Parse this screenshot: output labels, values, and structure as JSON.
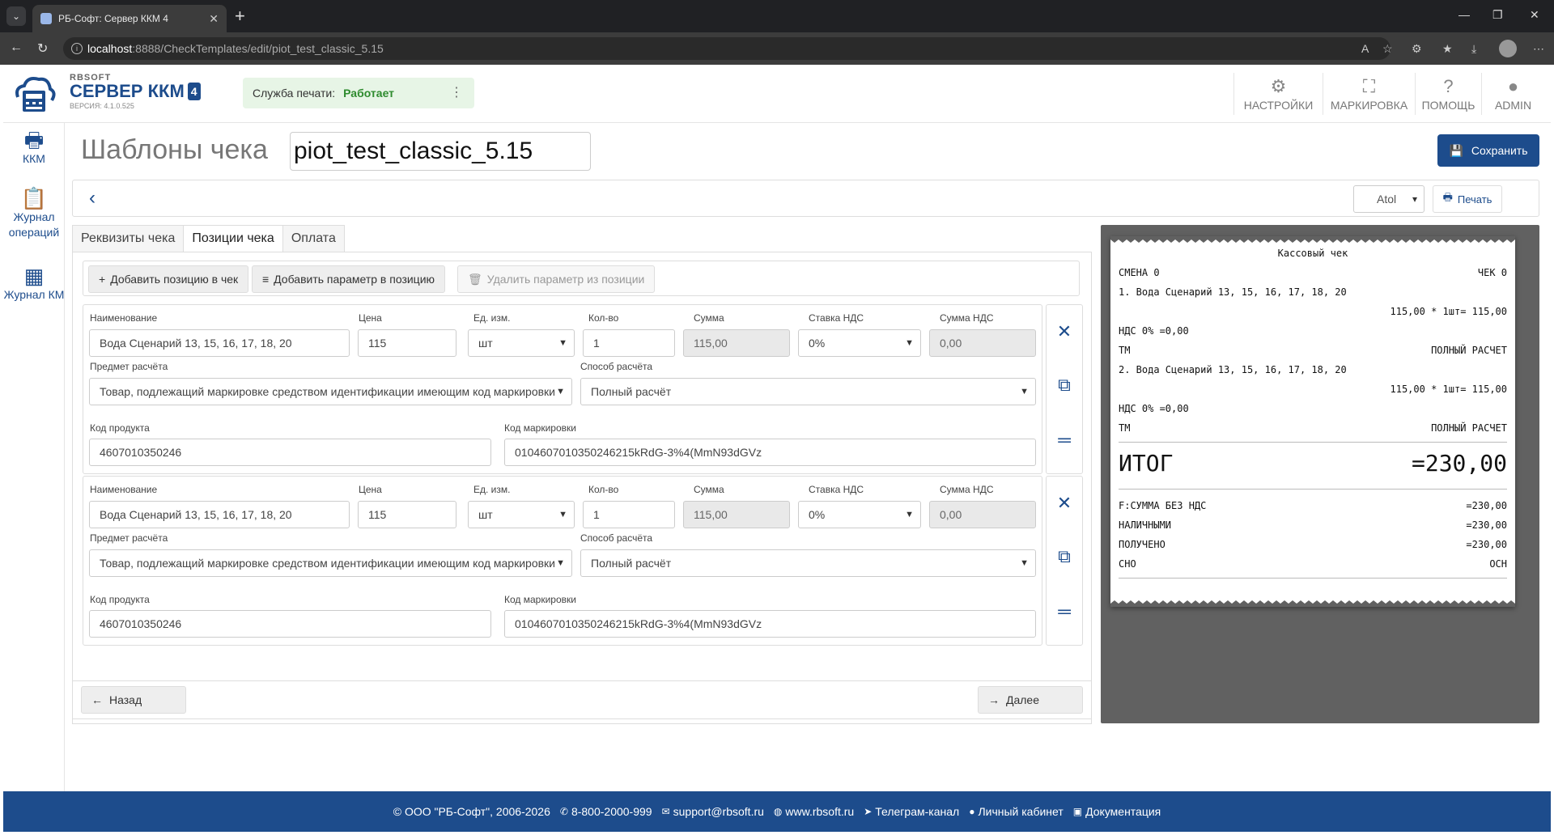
{
  "browser": {
    "tab_title": "РБ-Софт: Сервер ККМ 4",
    "url_host": "localhost",
    "url_path": ":8888/CheckTemplates/edit/piot_test_classic_5.15"
  },
  "header": {
    "logo_small": "RBSOFT",
    "logo_big": "СЕРВЕР ККМ",
    "logo_badge": "4",
    "version": "ВЕРСИЯ: 4.1.0.525",
    "print_service_label": "Служба печати:",
    "print_service_status": "Работает",
    "nav": [
      {
        "label": "НАСТРОЙКИ",
        "icon": "gear-icon"
      },
      {
        "label": "МАРКИРОВКА",
        "icon": "scan-icon"
      },
      {
        "label": "ПОМОЩЬ",
        "icon": "help-icon"
      },
      {
        "label": "ADMIN",
        "icon": "user-icon"
      }
    ]
  },
  "sidebar": {
    "items": [
      {
        "label": "ККМ",
        "icon": "printer-icon"
      },
      {
        "label": "Журнал операций",
        "icon": "clipboard-icon"
      },
      {
        "label": "Журнал КМ",
        "icon": "qr-icon"
      }
    ]
  },
  "main": {
    "title": "Шаблоны чека",
    "template_name": "piot_test_classic_5.15",
    "save_label": "Сохранить",
    "printer_value": "Atol",
    "print_label": "Печать",
    "tabs": [
      "Реквизиты чека",
      "Позиции чека",
      "Оплата"
    ],
    "actions": {
      "add_item": "Добавить позицию в чек",
      "add_param": "Добавить параметр в позицию",
      "remove_param": "Удалить параметр из позиции"
    },
    "labels": {
      "name": "Наименование",
      "price": "Цена",
      "unit": "Ед. изм.",
      "qty": "Кол-во",
      "sum": "Сумма",
      "vat_rate": "Ставка НДС",
      "vat_sum": "Сумма НДС",
      "subject": "Предмет расчёта",
      "method": "Способ расчёта",
      "product_code": "Код продукта",
      "mark_code": "Код маркировки"
    },
    "items": [
      {
        "name": "Вода Сценарий 13, 15, 16, 17, 18, 20",
        "price": "115",
        "unit": "шт",
        "qty": "1",
        "sum": "115,00",
        "vat_rate": "0%",
        "vat_sum": "0,00",
        "subject": "Товар, подлежащий маркировке средством идентификации имеющим код маркировки",
        "method": "Полный расчёт",
        "product_code": "4607010350246",
        "mark_code": "0104607010350246215kRdG-3%4(MmN93dGVz"
      },
      {
        "name": "Вода Сценарий 13, 15, 16, 17, 18, 20",
        "price": "115",
        "unit": "шт",
        "qty": "1",
        "sum": "115,00",
        "vat_rate": "0%",
        "vat_sum": "0,00",
        "subject": "Товар, подлежащий маркировке средством идентификации имеющим код маркировки",
        "method": "Полный расчёт",
        "product_code": "4607010350246",
        "mark_code": "0104607010350246215kRdG-3%4(MmN93dGVz"
      }
    ],
    "back_label": "Назад",
    "next_label": "Далее"
  },
  "receipt": {
    "title": "Кассовый чек",
    "shift": "СМЕНА 0",
    "check": "ЧЕК 0",
    "lines": [
      {
        "name": "1. Вода Сценарий 13, 15, 16, 17, 18, 20",
        "calc": "115,00 * 1шт= 115,00",
        "vat": "НДС 0% =0,00",
        "tm": "ТМ",
        "mode": "ПОЛНЫЙ РАСЧЕТ"
      },
      {
        "name": "2. Вода Сценарий 13, 15, 16, 17, 18, 20",
        "calc": "115,00 * 1шт= 115,00",
        "vat": "НДС 0% =0,00",
        "tm": "ТМ",
        "mode": "ПОЛНЫЙ РАСЧЕТ"
      }
    ],
    "total_label": "ИТОГ",
    "total_value": "=230,00",
    "summary": [
      {
        "label": "F:СУММА БЕЗ НДС",
        "value": "=230,00"
      },
      {
        "label": "НАЛИЧНЫМИ",
        "value": "=230,00"
      },
      {
        "label": "ПОЛУЧЕНО",
        "value": "=230,00"
      },
      {
        "label": "СНО",
        "value": "ОСН"
      }
    ]
  },
  "footer": {
    "copyright": "© ООО \"РБ-Софт\", 2006-2026",
    "phone": "8-800-2000-999",
    "email": "support@rbsoft.ru",
    "site": "www.rbsoft.ru",
    "telegram": "Телеграм-канал",
    "cabinet": "Личный кабинет",
    "docs": "Документация"
  },
  "colors": {
    "brand": "#1d4c8c",
    "status_ok": "#2e8b2e",
    "status_bg": "#e7f5e6",
    "preview_bg": "#616161"
  }
}
